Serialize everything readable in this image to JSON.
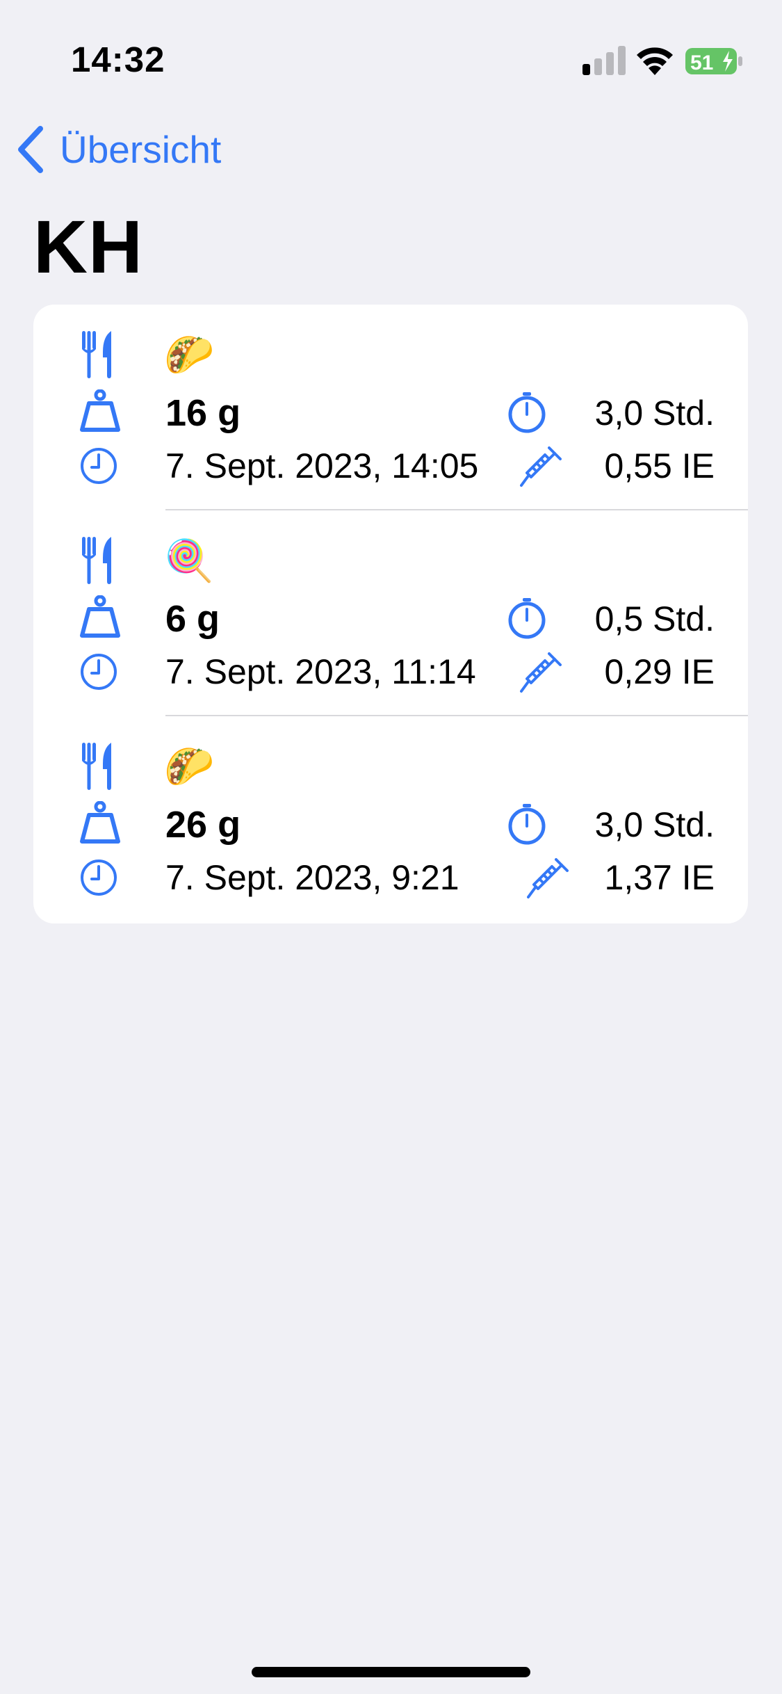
{
  "status_bar": {
    "time": "14:32",
    "battery_level": "51",
    "battery_color": "#65C466"
  },
  "navigation": {
    "back_label": "Übersicht"
  },
  "page": {
    "title": "KH"
  },
  "entries": [
    {
      "emoji": "🌮",
      "amount": "16 g",
      "datetime": "7. Sept. 2023, 14:05",
      "duration": "3,0 Std.",
      "insulin": "0,55 IE"
    },
    {
      "emoji": "🍭",
      "amount": "6 g",
      "datetime": "7. Sept. 2023, 11:14",
      "duration": "0,5 Std.",
      "insulin": "0,29 IE"
    },
    {
      "emoji": "🌮",
      "amount": "26 g",
      "datetime": "7. Sept. 2023, 9:21",
      "duration": "3,0 Std.",
      "insulin": "1,37 IE"
    }
  ],
  "colors": {
    "accent": "#3478F6",
    "background": "#F0F0F5",
    "card": "#FFFFFF",
    "separator": "#D8D8DC"
  }
}
